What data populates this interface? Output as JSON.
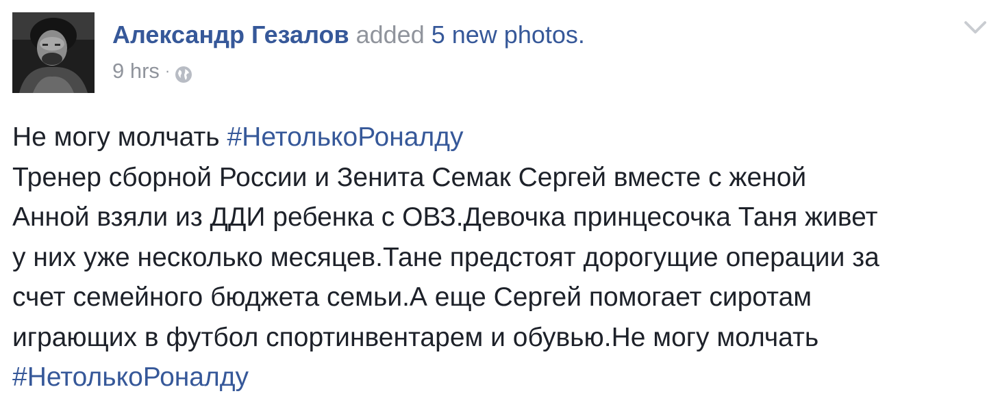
{
  "post": {
    "author_name": "Александр Гезалов",
    "action_text": "added",
    "photos_link": "5 new photos.",
    "timestamp": "9 hrs",
    "separator": "·",
    "privacy_icon": "globe-icon",
    "options_icon": "chevron-down-icon",
    "lines": [
      {
        "text": "Не могу молчать ",
        "hashtag": "#НетолькоРоналду"
      },
      {
        "text": "Тренер сборной России и Зенита Семак Сергей вместе с женой"
      },
      {
        "text": "Анной взяли из ДДИ ребенка с ОВЗ.Девочка принцесочка Таня живет"
      },
      {
        "text": "у них уже несколько месяцев.Тане предстоят дорогущие операции за"
      },
      {
        "text": "счет семейного бюджета семьи.А еще Сергей помогает сиротам"
      },
      {
        "text": "играющих в футбол спортинвентарем и обувью.Не могу молчать"
      },
      {
        "hashtag": "#НетолькоРоналду"
      }
    ]
  },
  "colors": {
    "link_blue": "#365899",
    "meta_gray": "#90949c",
    "text_dark": "#1d2129"
  }
}
